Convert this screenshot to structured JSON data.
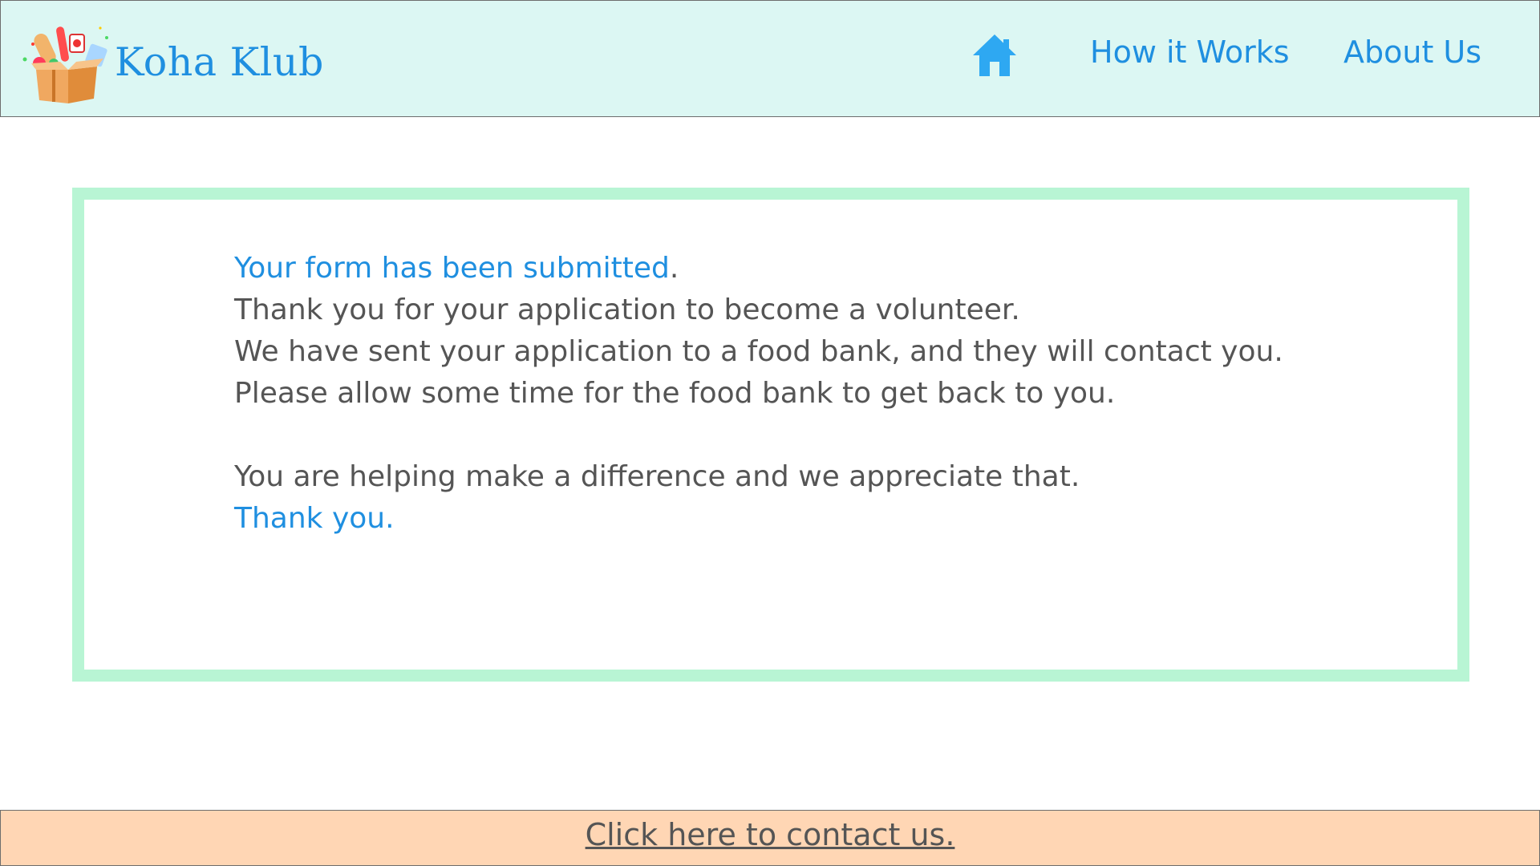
{
  "header": {
    "brand": "Koha Klub",
    "nav": {
      "home_icon": "home-icon",
      "how_it_works": "How it Works",
      "about_us": "About Us"
    }
  },
  "confirmation": {
    "headline": "Your form has been submitted",
    "headline_period": ".",
    "line1": "Thank you for your application to become a volunteer.",
    "line2": "We have sent your application to a food bank, and they will contact you.",
    "line3": "Please allow some time for the food bank to get back to you.",
    "line4": "You are helping make a difference and we appreciate that.",
    "closing": "Thank you."
  },
  "footer": {
    "contact_link": "Click here to contact us."
  },
  "colors": {
    "header_bg": "#dcf7f3",
    "accent_blue": "#1f8fe0",
    "panel_border": "#b8f5d4",
    "footer_bg": "#ffd6b4",
    "body_text": "#555555"
  }
}
